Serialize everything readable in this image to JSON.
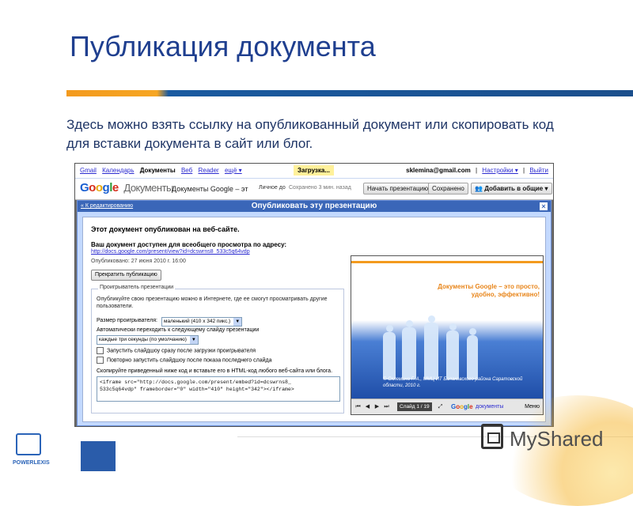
{
  "slide": {
    "title": "Публикация документа",
    "description": "Здесь можно взять ссылку на опубликованный документ или скопировать код для вставки документа в сайт или блог."
  },
  "google_bar": {
    "links": [
      "Gmail",
      "Календарь",
      "Документы",
      "Веб",
      "Reader",
      "ещё ▾"
    ],
    "current": "Документы",
    "loading": "Загрузка...",
    "user_email": "sklemina@gmail.com",
    "settings": "Настройки ▾",
    "logout": "Выйти"
  },
  "doc_header": {
    "logo_google": "Google",
    "logo_product": "Документы",
    "doc_title": "Документы Google – эт",
    "private": "Личное до",
    "saved": "Сохранено 3 мин. назад",
    "start_presentation": "Начать презентацию",
    "saved_button": "Сохранено",
    "add_public": "Добавить в общие"
  },
  "dialog": {
    "back_link": "« К редактированию",
    "title": "Опубликовать эту презентацию",
    "close": "×",
    "published_msg": "Этот документ опубликован на веб-сайте.",
    "available_label": "Ваш документ доступен для всеобщего просмотра по адресу:",
    "url": "http://docs.google.com/present/view?id=dcswrns8_533c5q64vdp",
    "published_date": "Опубликовано: 27 июня 2010 г. 16:00",
    "stop_button": "Прекратить публикацию",
    "player_legend": "Проигрыватель презентации",
    "player_desc": "Опубликуйте свою презентацию можно в Интернете, где ее смогут просматривать другие пользователи.",
    "size_label": "Размер проигрывателя:",
    "size_value": "маленький (410 x 342 пикс.)",
    "auto_label": "Автоматически переходить к следующему слайду презентации",
    "auto_value": "каждые три секунды (по умолчанию)",
    "check_start": "Запустить слайдшоу сразу после загрузки проигрывателя",
    "check_repeat": "Повторно запустить слайдшоу после показа последнего слайда",
    "copy_label": "Скопируйте приведенный ниже код и вставьте его в HTML-код любого веб-сайта или блога.",
    "embed_code": "<iframe src=\"http://docs.google.com/present/embed?id=dcswrns8_\n533c5q64vdp\" frameborder=\"0\" width=\"410\" height=\"342\"></iframe>"
  },
  "preview": {
    "slide_text": "Документы Google – это просто, удобно, эффективно!",
    "credit": "© Склемина Г. А., ММЦ ИТ Балаковского района Саратовской области, 2010 г.",
    "slide_counter": "Слайд 1 / 19",
    "google_logo": "Google",
    "product": "документы",
    "menu": "Меню"
  },
  "footer": {
    "mysharer": "MyShared",
    "powerlexis": "POWERLEXIS"
  },
  "colors": {
    "title": "#1f3f8f",
    "bar_orange": "#f39a1e",
    "bar_blue": "#1b4f8c",
    "dialog_header": "#3a66b8"
  }
}
